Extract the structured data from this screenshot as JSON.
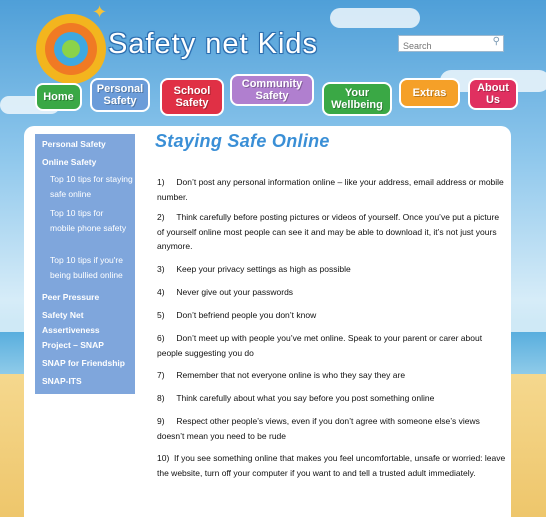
{
  "header": {
    "site_title": "Safety net Kids",
    "search_placeholder": "Search"
  },
  "tabs": [
    {
      "line1": "Home",
      "line2": "",
      "color": "#3aa845"
    },
    {
      "line1": "Personal",
      "line2": "Safety",
      "color": "#6b9cd9"
    },
    {
      "line1": "School",
      "line2": "Safety",
      "color": "#e03045"
    },
    {
      "line1": "Community",
      "line2": "Safety",
      "color": "#b07fcf"
    },
    {
      "line1": "Your",
      "line2": "Wellbeing",
      "color": "#3aa845"
    },
    {
      "line1": "Extras",
      "line2": "",
      "color": "#f5a028"
    },
    {
      "line1": "About",
      "line2": "Us",
      "color": "#e03060"
    }
  ],
  "sidebar": {
    "items": [
      {
        "label": "Personal Safety",
        "sub": false
      },
      {
        "label": "Online Safety",
        "sub": false
      },
      {
        "label": "Top 10 tips for staying safe online",
        "sub": true
      },
      {
        "label": "Top 10 tips for mobile phone safety",
        "sub": true
      },
      {
        "label": "Top 10 tips if you're being bullied online",
        "sub": true
      },
      {
        "label": "Peer Pressure",
        "sub": false
      },
      {
        "label": "Safety Net Assertiveness Project – SNAP",
        "sub": false
      },
      {
        "label": "SNAP for Friendship",
        "sub": false
      },
      {
        "label": "SNAP-ITS",
        "sub": false
      }
    ]
  },
  "main": {
    "title": "Staying Safe Online",
    "tips": [
      "1)     Don’t post any personal information online – like your address, email address or mobile number.",
      "2)     Think carefully before posting pictures or videos of yourself.  Once you’ve put  a picture of yourself online most people can see it and may be able to download it, it’s not just yours anymore.",
      "3)     Keep your privacy settings as high as possible",
      "4)     Never give out your passwords",
      "5)     Don’t befriend people you don’t know",
      "6)     Don’t meet up with people you’ve met online.  Speak to your parent or carer about people suggesting you do",
      "7)     Remember that not everyone online is who they say they are",
      "8)     Think carefully about what you say before you post something online",
      "9)     Respect other people’s views, even if you don’t agree with someone else’s views doesn’t mean you need to be rude",
      "10)  If you see something online that makes you feel uncomfortable, unsafe or worried: leave the website, turn off your computer if you want to and tell a trusted adult immediately."
    ]
  }
}
